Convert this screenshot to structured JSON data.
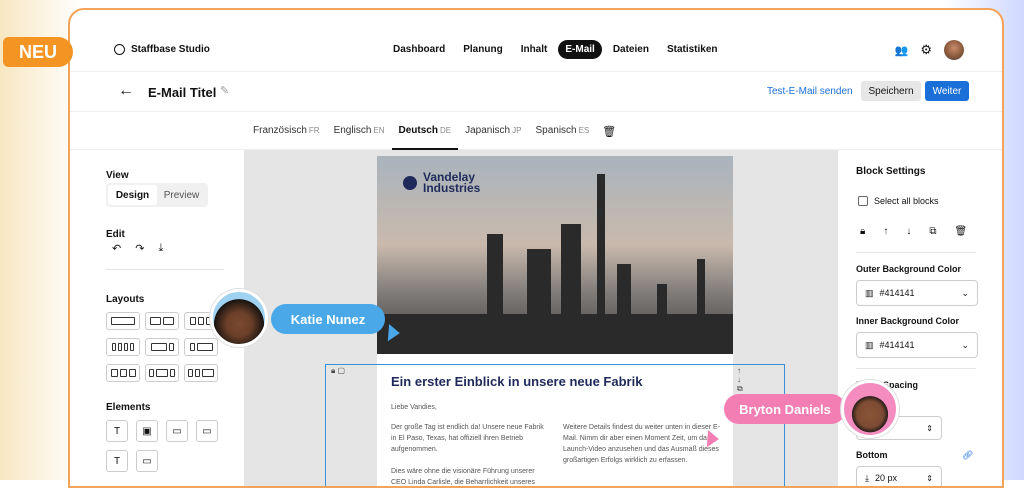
{
  "badge": "NEU",
  "brand": "Staffbase Studio",
  "nav": [
    "Dashboard",
    "Planung",
    "Inhalt",
    "E-Mail",
    "Dateien",
    "Statistiken"
  ],
  "title_bar": {
    "title": "E-Mail Titel",
    "test_mail": "Test-E-Mail senden",
    "save": "Speichern",
    "next": "Weiter"
  },
  "languages": [
    {
      "name": "Französisch",
      "code": "FR"
    },
    {
      "name": "Englisch",
      "code": "EN"
    },
    {
      "name": "Deutsch",
      "code": "DE"
    },
    {
      "name": "Japanisch",
      "code": "JP"
    },
    {
      "name": "Spanisch",
      "code": "ES"
    }
  ],
  "left": {
    "view": "View",
    "design": "Design",
    "preview": "Preview",
    "edit": "Edit",
    "layouts": "Layouts",
    "elements": "Elements"
  },
  "email": {
    "brand_line1": "Vandelay",
    "brand_line2": "Industries",
    "heading": "Ein erster Einblick in unsere neue Fabrik",
    "greeting": "Liebe Vandies,",
    "col1_p1": "Der große Tag ist endlich da! Unsere neue Fabrik in El Paso, Texas, hat offiziell ihren Betrieb aufgenommen.",
    "col1_p2": "Dies wäre ohne die visionäre Führung unserer CEO Linda Carlisle, die Beharrlichkeit unseres",
    "col2_p1": "Weitere Details findest du weiter unten in dieser E-Mail. Nimm dir aber einen Moment Zeit, um das Launch-Video anzusehen und das Ausmaß dieses großartigen Erfolgs wirklich zu erfassen."
  },
  "right": {
    "settings": "Block Settings",
    "select_all": "Select all blocks",
    "outer": "Outer Background Color",
    "outer_val": "#414141",
    "inner": "Inner Background Color",
    "inner_val": "#414141",
    "spacing": "Block Spacing",
    "bottom": "Bottom",
    "bottom_val": "20 px"
  },
  "callouts": {
    "katie": "Katie Nunez",
    "bryton": "Bryton Daniels"
  }
}
